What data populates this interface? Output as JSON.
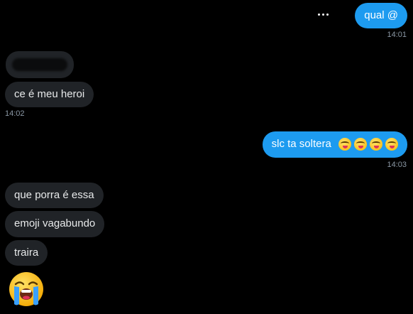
{
  "messages": {
    "m1": {
      "text": "qual @",
      "time": "14:01"
    },
    "m2": {
      "text": "ce é meu heroi",
      "time": "14:02"
    },
    "m3": {
      "text": "slc ta soltera",
      "time": "14:03",
      "emoji_icons": [
        "yum-face-icon",
        "yum-face-icon",
        "yum-face-icon",
        "yum-face-icon"
      ]
    },
    "m4": {
      "text": "que porra é essa"
    },
    "m5": {
      "text": "emoji vagabundo"
    },
    "m6": {
      "text": "traira"
    },
    "m7": {
      "emoji_icon": "loudly-crying-face-icon"
    }
  },
  "colors": {
    "background": "#000000",
    "sent_bubble": "#1d9bf0",
    "received_bubble": "#202327",
    "timestamp": "#8b98a5"
  },
  "icons": {
    "more_options": "more-options-icon"
  }
}
